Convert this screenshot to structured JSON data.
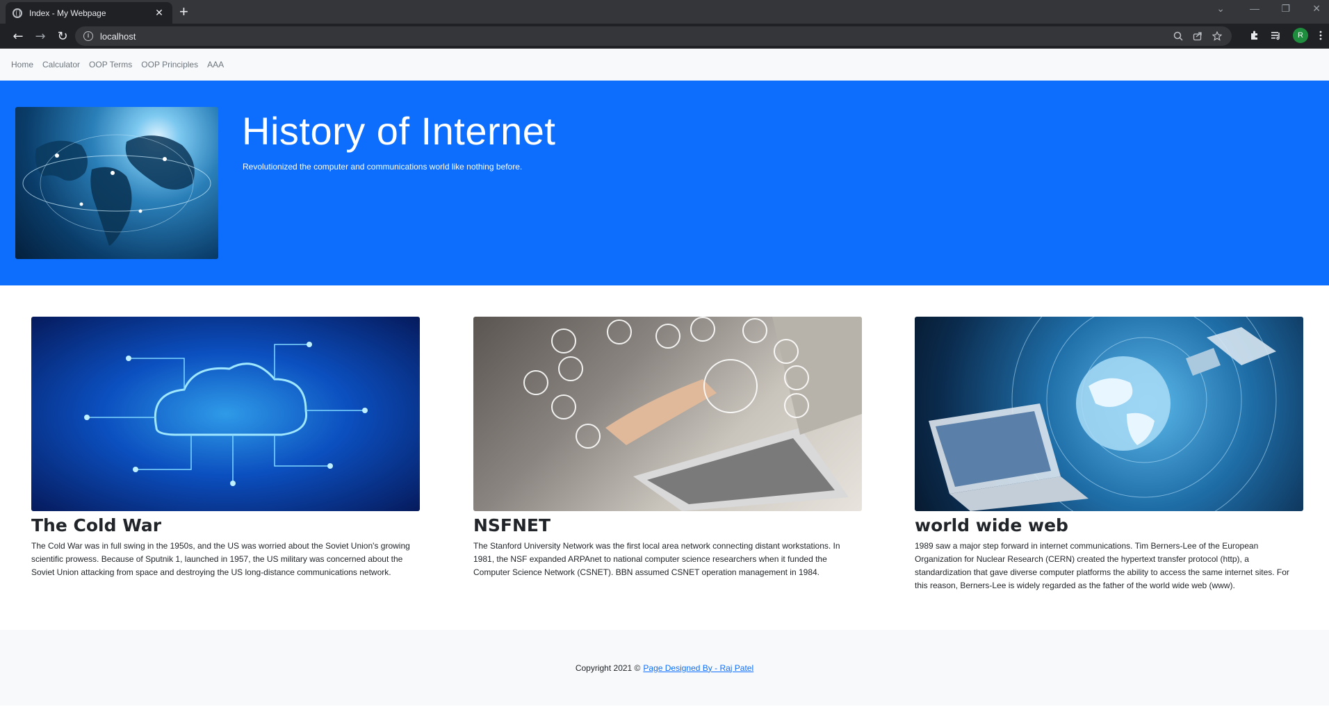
{
  "browser": {
    "tab_title": "Index - My Webpage",
    "tab_close": "✕",
    "new_tab": "+",
    "url": "localhost",
    "back": "←",
    "forward": "→",
    "reload": "↻",
    "window_minimize": "—",
    "window_restore": "❐",
    "window_close": "✕",
    "tab_search": "⌄",
    "profile_initial": "R"
  },
  "nav": {
    "items": [
      "Home",
      "Calculator",
      "OOP Terms",
      "OOP Principles",
      "AAA"
    ]
  },
  "hero": {
    "title": "History of Internet",
    "subtitle": "Revolutionized the computer and communications world like nothing before."
  },
  "cards": [
    {
      "title": "The Cold War",
      "text": "The Cold War was in full swing in the 1950s, and the US was worried about the Soviet Union's growing scientific prowess. Because of Sputnik 1, launched in 1957, the US military was concerned about the Soviet Union attacking from space and destroying the US long-distance communications network."
    },
    {
      "title": "NSFNET",
      "text": "The Stanford University Network was the first local area network connecting distant workstations. In 1981, the NSF expanded ARPAnet to national computer science researchers when it funded the Computer Science Network (CSNET). BBN assumed CSNET operation management in 1984."
    },
    {
      "title": "world wide web",
      "text": "1989 saw a major step forward in internet communications. Tim Berners-Lee of the European Organization for Nuclear Research (CERN) created the hypertext transfer protocol (http), a standardization that gave diverse computer platforms the ability to access the same internet sites. For this reason, Berners-Lee is widely regarded as the father of the world wide web (www)."
    }
  ],
  "footer": {
    "copyright": "Copyright 2021 ©",
    "link_text": "Page Designed By - Raj Patel"
  },
  "colors": {
    "hero_bg": "#0d6efd",
    "nav_bg": "#f8f9fa",
    "footer_bg": "#f8f9fa"
  }
}
